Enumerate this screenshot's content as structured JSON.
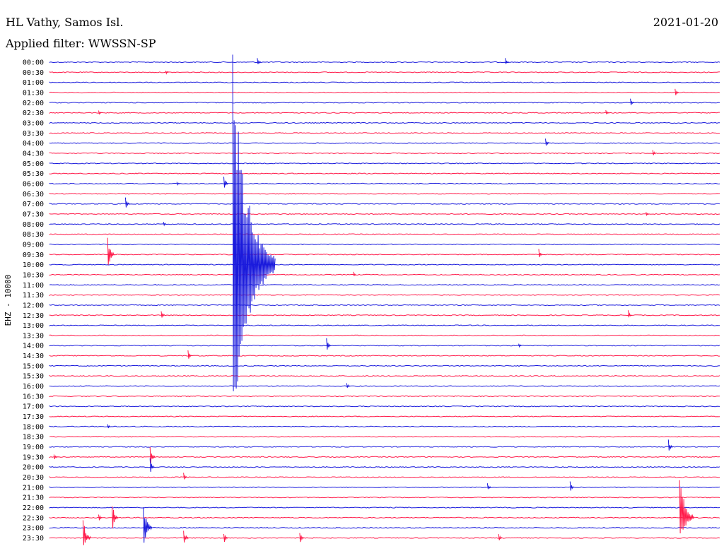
{
  "header": {
    "station": "HL Vathy, Samos Isl.",
    "filter": "Applied filter: WWSSN-SP",
    "date": "2021-01-20"
  },
  "colors": {
    "even": "#1a1adc",
    "odd": "#ff1a4a"
  },
  "chart_data": {
    "type": "line",
    "title": "HL Vathy, Samos Isl.",
    "subtitle": "Applied filter: WWSSN-SP",
    "date": "2021-01-20",
    "ylabel": "EHZ - 10000",
    "rows": [
      "00:00",
      "00:30",
      "01:00",
      "01:30",
      "02:00",
      "02:30",
      "03:00",
      "03:30",
      "04:00",
      "04:30",
      "05:00",
      "05:30",
      "06:00",
      "06:30",
      "07:00",
      "07:30",
      "08:00",
      "08:30",
      "09:00",
      "09:30",
      "10:00",
      "10:30",
      "11:00",
      "11:30",
      "12:00",
      "12:30",
      "13:00",
      "13:30",
      "14:00",
      "14:30",
      "15:00",
      "15:30",
      "16:00",
      "16:30",
      "17:00",
      "17:30",
      "18:00",
      "18:30",
      "19:00",
      "19:30",
      "20:00",
      "20:30",
      "21:00",
      "21:30",
      "22:00",
      "22:30",
      "23:00",
      "23:30"
    ],
    "row_colors": [
      "blue",
      "red"
    ],
    "minutes_per_row": 30,
    "events": [
      {
        "row": 0,
        "minute": 9.3,
        "amp": 0.5
      },
      {
        "row": 0,
        "minute": 20.4,
        "amp": 0.4
      },
      {
        "row": 1,
        "minute": 5.2,
        "amp": 0.25
      },
      {
        "row": 3,
        "minute": 28.0,
        "amp": 0.5
      },
      {
        "row": 4,
        "minute": 26.0,
        "amp": 0.5
      },
      {
        "row": 5,
        "minute": 2.2,
        "amp": 0.3
      },
      {
        "row": 5,
        "minute": 24.9,
        "amp": 0.35
      },
      {
        "row": 8,
        "minute": 22.2,
        "amp": 0.6
      },
      {
        "row": 9,
        "minute": 27.0,
        "amp": 0.4
      },
      {
        "row": 12,
        "minute": 5.7,
        "amp": 0.3
      },
      {
        "row": 12,
        "minute": 7.8,
        "amp": 0.9
      },
      {
        "row": 14,
        "minute": 3.4,
        "amp": 0.7
      },
      {
        "row": 15,
        "minute": 26.7,
        "amp": 0.3
      },
      {
        "row": 16,
        "minute": 5.1,
        "amp": 0.3
      },
      {
        "row": 19,
        "minute": 2.6,
        "amp": 1.9
      },
      {
        "row": 19,
        "minute": 21.9,
        "amp": 0.6
      },
      {
        "row": 20,
        "minute": 8.2,
        "amp": 21.0
      },
      {
        "row": 21,
        "minute": 13.6,
        "amp": 0.3
      },
      {
        "row": 25,
        "minute": 5.0,
        "amp": 0.6
      },
      {
        "row": 25,
        "minute": 25.9,
        "amp": 0.5
      },
      {
        "row": 28,
        "minute": 12.4,
        "amp": 0.8
      },
      {
        "row": 28,
        "minute": 21.0,
        "amp": 0.3
      },
      {
        "row": 29,
        "minute": 6.2,
        "amp": 0.6
      },
      {
        "row": 32,
        "minute": 13.3,
        "amp": 0.4
      },
      {
        "row": 36,
        "minute": 2.6,
        "amp": 0.3
      },
      {
        "row": 38,
        "minute": 27.7,
        "amp": 0.8
      },
      {
        "row": 39,
        "minute": 0.2,
        "amp": 0.4
      },
      {
        "row": 39,
        "minute": 4.5,
        "amp": 1.1
      },
      {
        "row": 40,
        "minute": 4.5,
        "amp": 0.9
      },
      {
        "row": 41,
        "minute": 6.0,
        "amp": 0.5
      },
      {
        "row": 42,
        "minute": 19.6,
        "amp": 0.5
      },
      {
        "row": 42,
        "minute": 23.3,
        "amp": 0.6
      },
      {
        "row": 45,
        "minute": 2.8,
        "amp": 1.6
      },
      {
        "row": 45,
        "minute": 2.2,
        "amp": 0.5
      },
      {
        "row": 45,
        "minute": 28.2,
        "amp": 5.4
      },
      {
        "row": 46,
        "minute": 4.2,
        "amp": 2.8
      },
      {
        "row": 47,
        "minute": 1.5,
        "amp": 2.5
      },
      {
        "row": 47,
        "minute": 6.0,
        "amp": 1.0
      },
      {
        "row": 47,
        "minute": 7.8,
        "amp": 0.7
      },
      {
        "row": 47,
        "minute": 11.2,
        "amp": 0.7
      },
      {
        "row": 47,
        "minute": 20.1,
        "amp": 0.5
      }
    ]
  }
}
